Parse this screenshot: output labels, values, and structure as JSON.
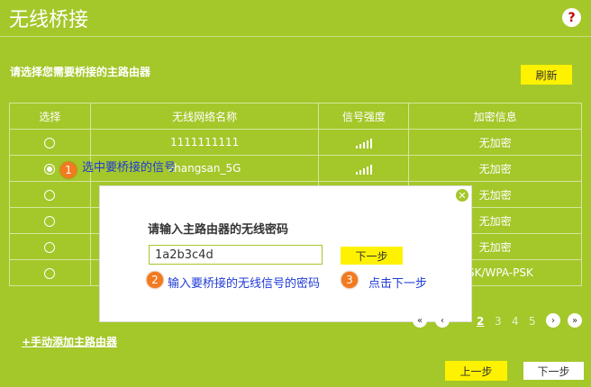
{
  "page": {
    "title": "无线桥接",
    "help_glyph": "?"
  },
  "instruction": "请选择您需要桥接的主路由器",
  "refresh_label": "刷新",
  "table": {
    "headers": [
      "选择",
      "无线网络名称",
      "信号强度",
      "加密信息"
    ],
    "rows": [
      {
        "ssid": "1111111111",
        "encryption": "无加密",
        "selected": false
      },
      {
        "ssid": "zhangsan_5G",
        "encryption": "无加密",
        "selected": true
      },
      {
        "ssid": "",
        "encryption": "无加密",
        "selected": false
      },
      {
        "ssid": "",
        "encryption": "无加密",
        "selected": false
      },
      {
        "ssid": "",
        "encryption": "无加密",
        "selected": false
      },
      {
        "ssid": "",
        "encryption": "-PSK/WPA-PSK",
        "selected": false
      }
    ]
  },
  "dialog": {
    "title": "请输入主路由器的无线密码",
    "password": "1a2b3c4d",
    "next_label": "下一步"
  },
  "annotations": [
    {
      "num": "1",
      "text": "选中要桥接的信号"
    },
    {
      "num": "2",
      "text": "输入要桥接的无线信号的密码"
    },
    {
      "num": "3",
      "text": "点击下一步"
    }
  ],
  "pagination": {
    "pages": [
      "2",
      "3",
      "4",
      "5"
    ],
    "current": "2"
  },
  "manual_add": "+手动添加主路由器",
  "footer": {
    "prev_label": "上一步",
    "next_label": "下一步"
  }
}
